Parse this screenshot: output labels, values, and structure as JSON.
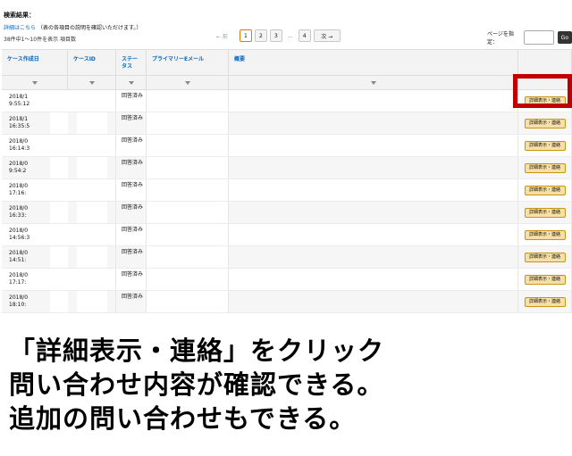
{
  "header": {
    "title": "検索結果：",
    "details_link": "詳細はこちら",
    "details_note": "（表の各項目の説明を確認いただけます。）",
    "result_count": "38件中1〜10件を表示 項目数"
  },
  "pager": {
    "prev": "← 前",
    "pages": [
      "1",
      "2",
      "3"
    ],
    "dots": "...",
    "last": "4",
    "next": "次 →"
  },
  "goto": {
    "label": "ページを指定：",
    "value": "",
    "button": "Go"
  },
  "table": {
    "columns": [
      "ケース作成日",
      "ケースID",
      "ステータス",
      "プライマリーEメール",
      "概要",
      ""
    ],
    "action_label": "詳細表示・連絡",
    "rows": [
      {
        "date": "2018/1",
        "time": "9:55:12",
        "status": "回答済み"
      },
      {
        "date": "2018/1",
        "time": "16:35:5",
        "status": "回答済み"
      },
      {
        "date": "2018/0",
        "time": "16:14:3",
        "status": "回答済み"
      },
      {
        "date": "2018/0",
        "time": "9:54:2",
        "status": "回答済み"
      },
      {
        "date": "2018/0",
        "time": "17:16:",
        "status": "回答済み"
      },
      {
        "date": "2018/0",
        "time": "16:33:",
        "status": "回答済み"
      },
      {
        "date": "2018/0",
        "time": "14:56:3",
        "status": "回答済み"
      },
      {
        "date": "2018/0",
        "time": "14:51:",
        "status": "回答済み"
      },
      {
        "date": "2018/0",
        "time": "17:17:",
        "status": "回答済み"
      },
      {
        "date": "2018/0",
        "time": "18:10:",
        "status": "回答済み"
      }
    ]
  },
  "caption": {
    "line1": "「詳細表示・連絡」をクリック",
    "line2": "問い合わせ内容が確認できる。",
    "line3": "追加の問い合わせもできる。"
  },
  "colors": {
    "highlight": "#c00000",
    "button_bg": "#f7dfa5",
    "link": "#0066c0"
  }
}
